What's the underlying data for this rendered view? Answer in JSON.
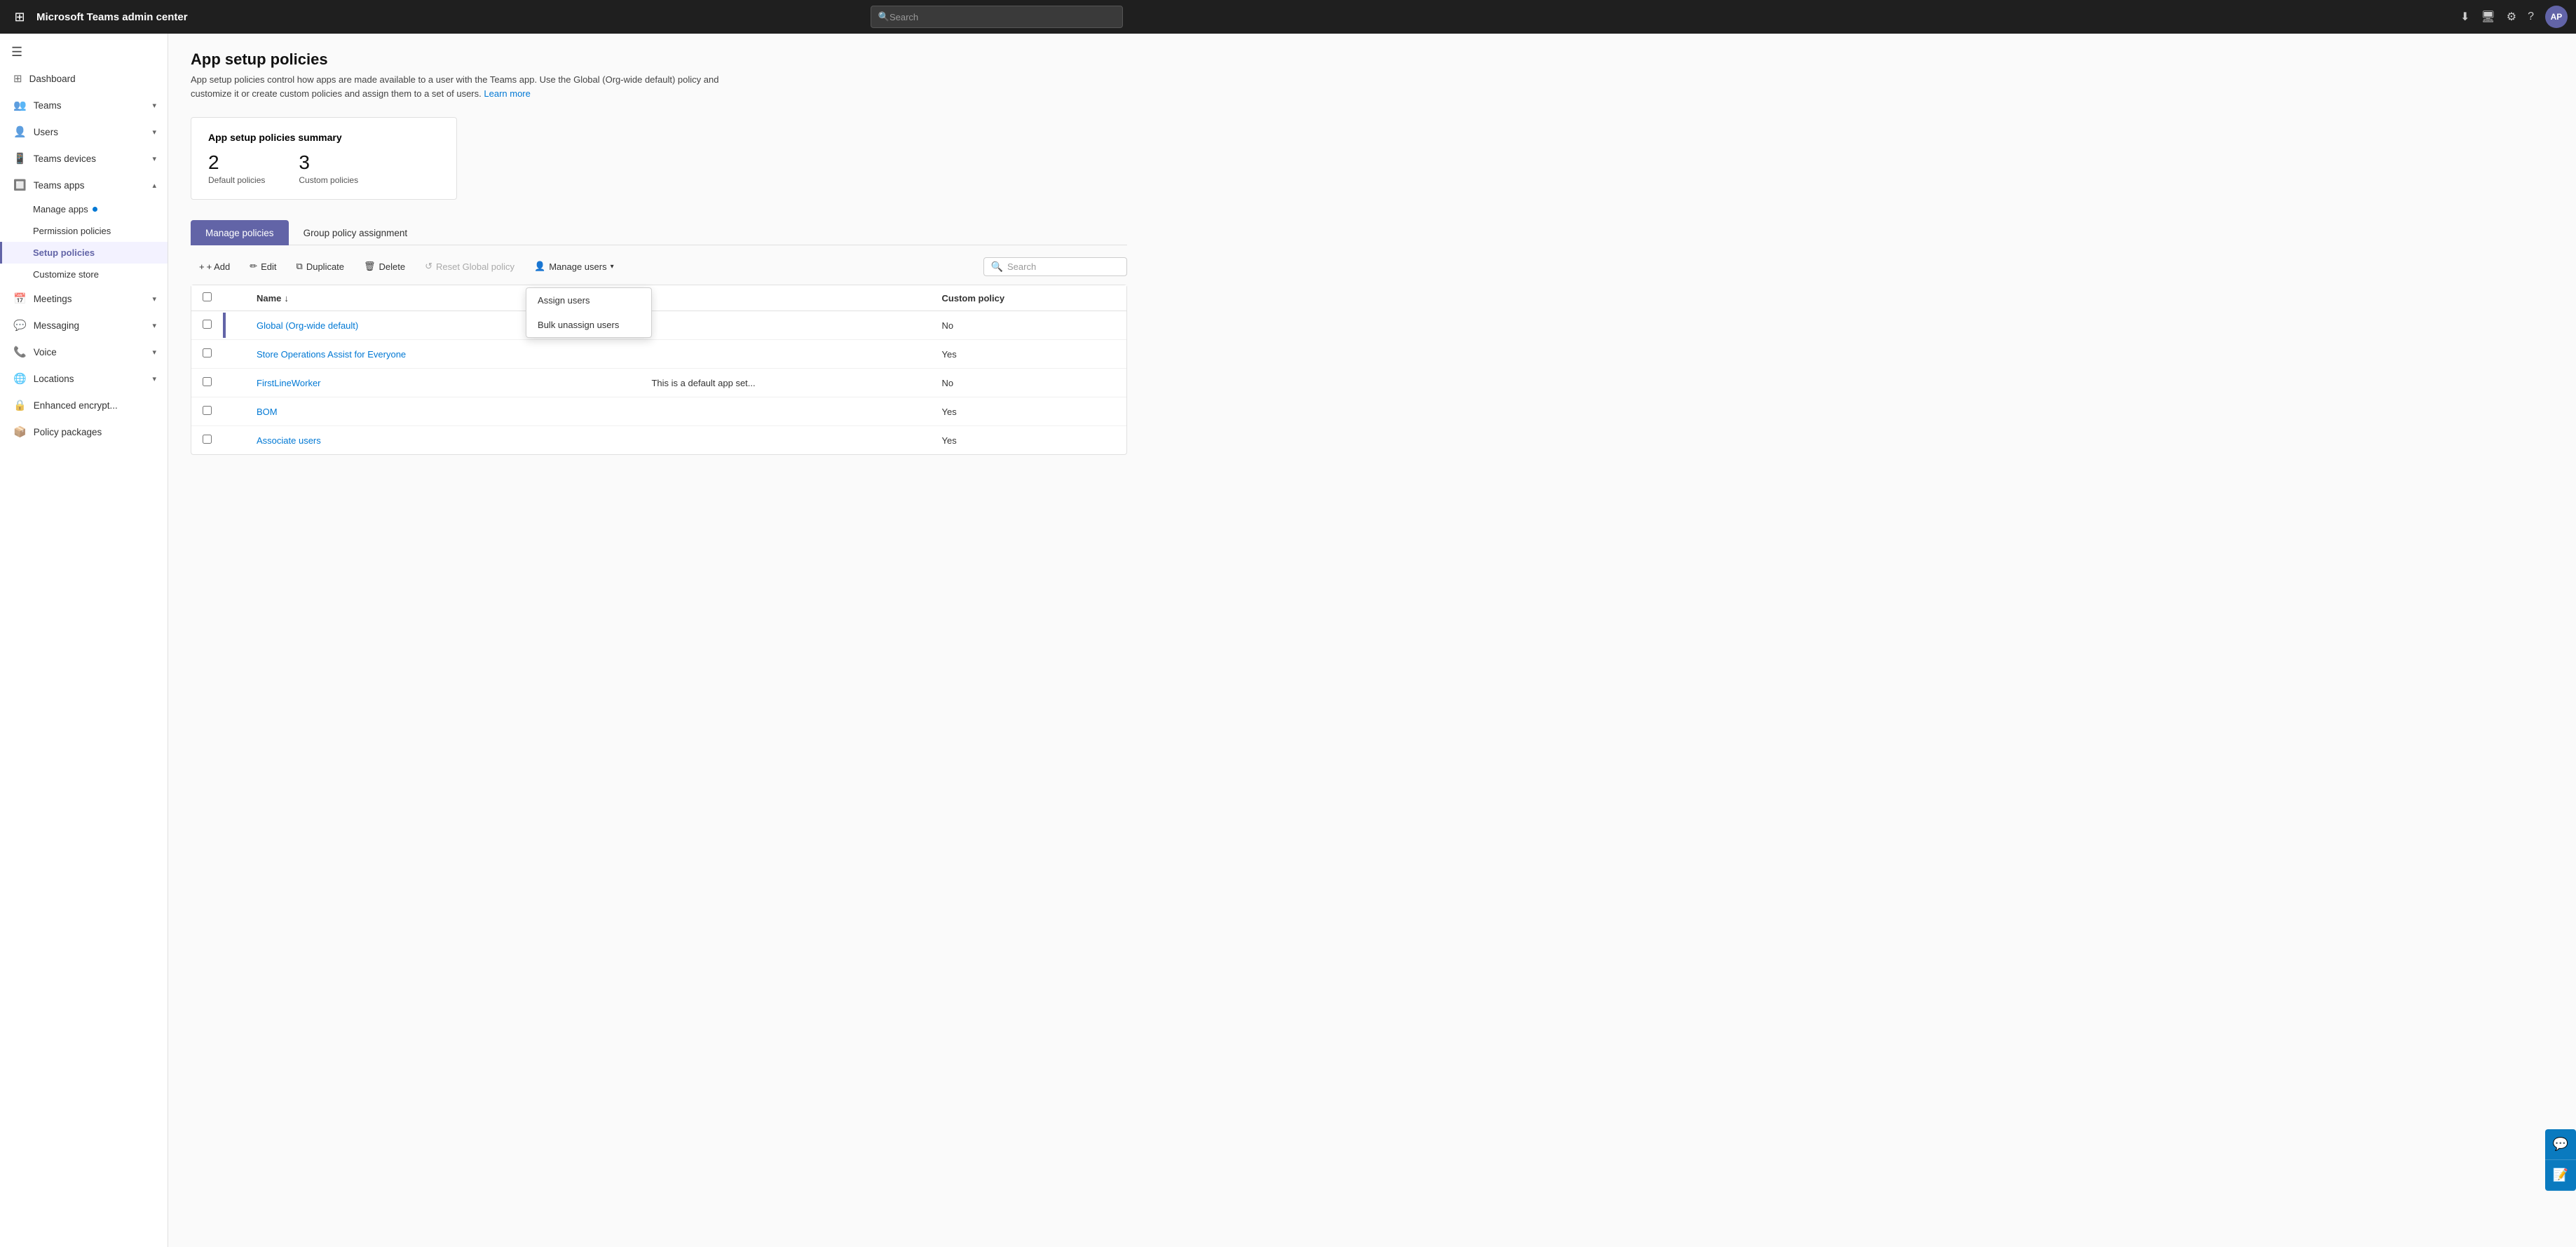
{
  "topbar": {
    "title": "Microsoft Teams admin center",
    "search_placeholder": "Search",
    "avatar_initials": "AP"
  },
  "sidebar": {
    "hamburger_icon": "☰",
    "items": [
      {
        "id": "dashboard",
        "label": "Dashboard",
        "icon": "⊞",
        "expandable": false
      },
      {
        "id": "teams",
        "label": "Teams",
        "icon": "👥",
        "expandable": true,
        "expanded": false
      },
      {
        "id": "users",
        "label": "Users",
        "icon": "👤",
        "expandable": true,
        "expanded": false
      },
      {
        "id": "teams-devices",
        "label": "Teams devices",
        "icon": "📱",
        "expandable": true,
        "expanded": false
      },
      {
        "id": "teams-apps",
        "label": "Teams apps",
        "icon": "🔲",
        "expandable": true,
        "expanded": true
      },
      {
        "id": "meetings",
        "label": "Meetings",
        "icon": "📅",
        "expandable": true,
        "expanded": false
      },
      {
        "id": "messaging",
        "label": "Messaging",
        "icon": "💬",
        "expandable": true,
        "expanded": false
      },
      {
        "id": "voice",
        "label": "Voice",
        "icon": "📞",
        "expandable": true,
        "expanded": false
      },
      {
        "id": "locations",
        "label": "Locations",
        "icon": "🌐",
        "expandable": true,
        "expanded": false
      },
      {
        "id": "enhanced-encrypt",
        "label": "Enhanced encrypt...",
        "icon": "🔒",
        "expandable": false
      },
      {
        "id": "policy-packages",
        "label": "Policy packages",
        "icon": "📦",
        "expandable": false
      }
    ],
    "teams_apps_sub": [
      {
        "id": "manage-apps",
        "label": "Manage apps",
        "has_dot": true
      },
      {
        "id": "permission-policies",
        "label": "Permission policies",
        "has_dot": false
      },
      {
        "id": "setup-policies",
        "label": "Setup policies",
        "has_dot": false
      },
      {
        "id": "customize-store",
        "label": "Customize store",
        "has_dot": false
      }
    ]
  },
  "main": {
    "page_title": "App setup policies",
    "page_description": "App setup policies control how apps are made available to a user with the Teams app. Use the Global (Org-wide default) policy and customize it or create custom policies and assign them to a set of users.",
    "learn_more_text": "Learn more",
    "summary_card": {
      "title": "App setup policies summary",
      "default_policies_count": "2",
      "default_policies_label": "Default policies",
      "custom_policies_count": "3",
      "custom_policies_label": "Custom policies"
    },
    "tabs": [
      {
        "id": "manage-policies",
        "label": "Manage policies",
        "active": true
      },
      {
        "id": "group-policy-assignment",
        "label": "Group policy assignment",
        "active": false
      }
    ],
    "toolbar": {
      "add_label": "+ Add",
      "edit_label": "Edit",
      "duplicate_label": "Duplicate",
      "delete_label": "Delete",
      "reset_label": "Reset Global policy",
      "manage_users_label": "Manage users",
      "search_placeholder": "Search"
    },
    "dropdown_menu": {
      "items": [
        {
          "id": "assign-users",
          "label": "Assign users"
        },
        {
          "id": "bulk-unassign",
          "label": "Bulk unassign users"
        }
      ]
    },
    "table": {
      "columns": [
        {
          "id": "name",
          "label": "Name",
          "sortable": true
        },
        {
          "id": "description",
          "label": ""
        },
        {
          "id": "custom-policy",
          "label": "Custom policy"
        }
      ],
      "rows": [
        {
          "id": "global",
          "name": "Global (Org-wide default)",
          "description": "",
          "custom_policy": "No",
          "indicator": true
        },
        {
          "id": "store-ops",
          "name": "Store Operations Assist for Everyone",
          "description": "",
          "custom_policy": "Yes",
          "indicator": false
        },
        {
          "id": "firstline",
          "name": "FirstLineWorker",
          "description": "This is a default app set...",
          "custom_policy": "No",
          "indicator": false
        },
        {
          "id": "bom",
          "name": "BOM",
          "description": "",
          "custom_policy": "Yes",
          "indicator": false
        },
        {
          "id": "associate-users",
          "name": "Associate users",
          "description": "",
          "custom_policy": "Yes",
          "indicator": false
        }
      ]
    }
  },
  "colors": {
    "accent": "#6264a7",
    "link": "#0078d4",
    "active_tab_bg": "#6264a7"
  }
}
